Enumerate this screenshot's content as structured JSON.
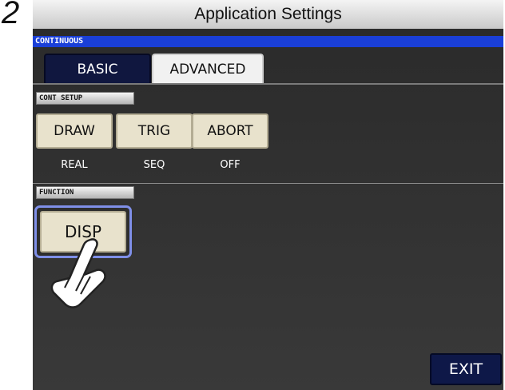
{
  "step": "2",
  "window": {
    "title": "Application Settings"
  },
  "mode": {
    "label": "CONTINUOUS",
    "color": "#1a3fd8"
  },
  "tabs": [
    {
      "label": "BASIC",
      "active": false
    },
    {
      "label": "ADVANCED",
      "active": true
    }
  ],
  "cont_setup": {
    "heading": "CONT SETUP",
    "buttons": [
      {
        "label": "DRAW",
        "value": "REAL"
      },
      {
        "label": "TRIG",
        "value": "SEQ"
      },
      {
        "label": "ABORT",
        "value": "OFF"
      }
    ]
  },
  "function": {
    "heading": "FUNCTION",
    "disp_label": "DISP",
    "pointer": "hand-pointer-icon"
  },
  "footer": {
    "exit_label": "EXIT"
  }
}
